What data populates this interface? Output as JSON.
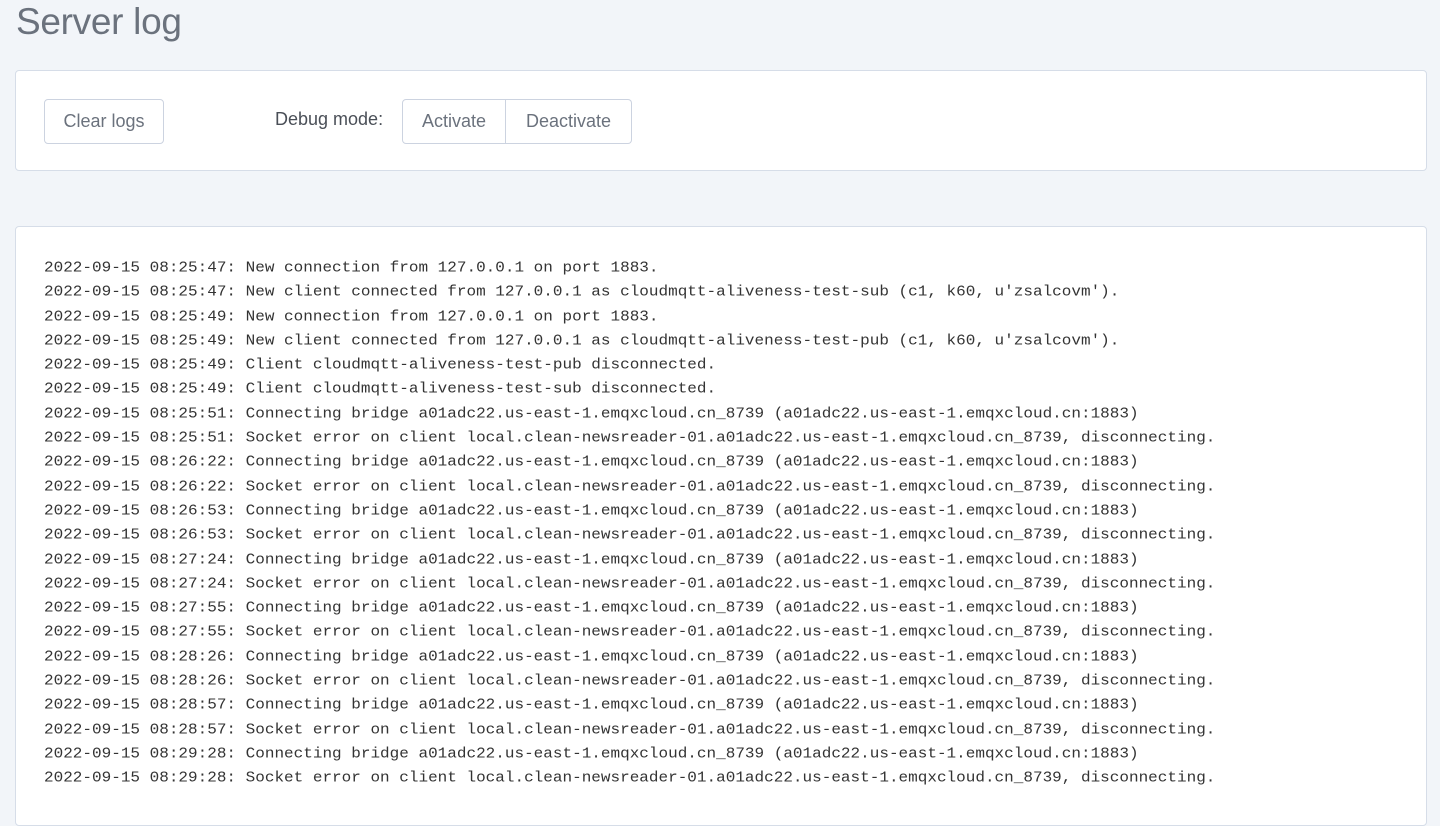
{
  "page": {
    "title": "Server log"
  },
  "toolbar": {
    "clear_label": "Clear logs",
    "debug_label": "Debug mode:",
    "activate_label": "Activate",
    "deactivate_label": "Deactivate"
  },
  "log": {
    "lines": [
      "2022-09-15 08:25:47: New connection from 127.0.0.1 on port 1883.",
      "2022-09-15 08:25:47: New client connected from 127.0.0.1 as cloudmqtt-aliveness-test-sub (c1, k60, u'zsalcovm').",
      "2022-09-15 08:25:49: New connection from 127.0.0.1 on port 1883.",
      "2022-09-15 08:25:49: New client connected from 127.0.0.1 as cloudmqtt-aliveness-test-pub (c1, k60, u'zsalcovm').",
      "2022-09-15 08:25:49: Client cloudmqtt-aliveness-test-pub disconnected.",
      "2022-09-15 08:25:49: Client cloudmqtt-aliveness-test-sub disconnected.",
      "2022-09-15 08:25:51: Connecting bridge a01adc22.us-east-1.emqxcloud.cn_8739 (a01adc22.us-east-1.emqxcloud.cn:1883)",
      "2022-09-15 08:25:51: Socket error on client local.clean-newsreader-01.a01adc22.us-east-1.emqxcloud.cn_8739, disconnecting.",
      "2022-09-15 08:26:22: Connecting bridge a01adc22.us-east-1.emqxcloud.cn_8739 (a01adc22.us-east-1.emqxcloud.cn:1883)",
      "2022-09-15 08:26:22: Socket error on client local.clean-newsreader-01.a01adc22.us-east-1.emqxcloud.cn_8739, disconnecting.",
      "2022-09-15 08:26:53: Connecting bridge a01adc22.us-east-1.emqxcloud.cn_8739 (a01adc22.us-east-1.emqxcloud.cn:1883)",
      "2022-09-15 08:26:53: Socket error on client local.clean-newsreader-01.a01adc22.us-east-1.emqxcloud.cn_8739, disconnecting.",
      "2022-09-15 08:27:24: Connecting bridge a01adc22.us-east-1.emqxcloud.cn_8739 (a01adc22.us-east-1.emqxcloud.cn:1883)",
      "2022-09-15 08:27:24: Socket error on client local.clean-newsreader-01.a01adc22.us-east-1.emqxcloud.cn_8739, disconnecting.",
      "2022-09-15 08:27:55: Connecting bridge a01adc22.us-east-1.emqxcloud.cn_8739 (a01adc22.us-east-1.emqxcloud.cn:1883)",
      "2022-09-15 08:27:55: Socket error on client local.clean-newsreader-01.a01adc22.us-east-1.emqxcloud.cn_8739, disconnecting.",
      "2022-09-15 08:28:26: Connecting bridge a01adc22.us-east-1.emqxcloud.cn_8739 (a01adc22.us-east-1.emqxcloud.cn:1883)",
      "2022-09-15 08:28:26: Socket error on client local.clean-newsreader-01.a01adc22.us-east-1.emqxcloud.cn_8739, disconnecting.",
      "2022-09-15 08:28:57: Connecting bridge a01adc22.us-east-1.emqxcloud.cn_8739 (a01adc22.us-east-1.emqxcloud.cn:1883)",
      "2022-09-15 08:28:57: Socket error on client local.clean-newsreader-01.a01adc22.us-east-1.emqxcloud.cn_8739, disconnecting.",
      "2022-09-15 08:29:28: Connecting bridge a01adc22.us-east-1.emqxcloud.cn_8739 (a01adc22.us-east-1.emqxcloud.cn:1883)",
      "2022-09-15 08:29:28: Socket error on client local.clean-newsreader-01.a01adc22.us-east-1.emqxcloud.cn_8739, disconnecting."
    ]
  }
}
